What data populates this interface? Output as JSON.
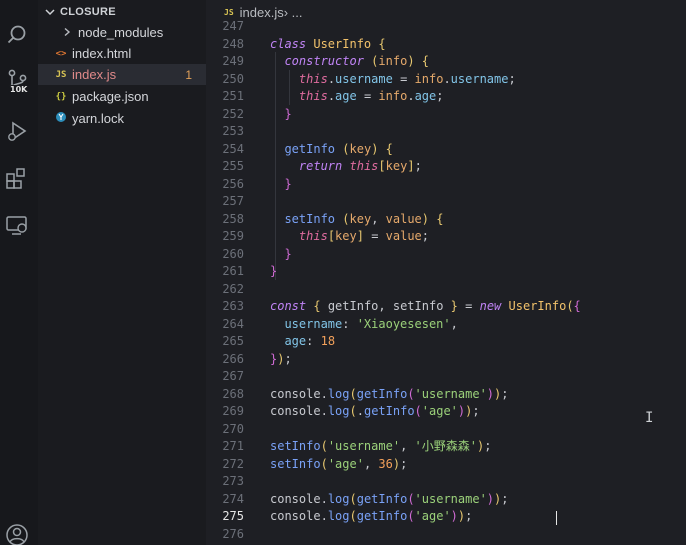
{
  "activity_bar": {
    "icons": [
      "search-icon",
      "source-control-icon",
      "run-debug-icon",
      "extensions-icon",
      "remote-explorer-icon",
      "account-icon"
    ],
    "badge": "10K"
  },
  "explorer": {
    "section_title": "CLOSURE",
    "items": [
      {
        "label": "node_modules",
        "icon": ">",
        "type": "folder"
      },
      {
        "label": "index.html",
        "icon": "<>",
        "type": "html"
      },
      {
        "label": "index.js",
        "icon": "JS",
        "type": "js",
        "count": "1"
      },
      {
        "label": "package.json",
        "icon": "{}",
        "type": "json"
      },
      {
        "label": "yarn.lock",
        "icon": "yarn-icon",
        "type": "yarn"
      }
    ]
  },
  "editor": {
    "breadcrumb_icon": "JS",
    "breadcrumb_file": "index.js",
    "breadcrumb_sep": " › ...",
    "line_numbers": [
      "247",
      "248",
      "249",
      "250",
      "251",
      "252",
      "253",
      "254",
      "255",
      "256",
      "257",
      "258",
      "259",
      "260",
      "261",
      "262",
      "263",
      "264",
      "265",
      "266",
      "267",
      "268",
      "269",
      "270",
      "271",
      "272",
      "273",
      "274",
      "275",
      "276"
    ],
    "current_line": "275",
    "lines": [
      "",
      "class UserInfo {",
      "  constructor (info) {",
      "    this.username = info.username;",
      "    this.age = info.age;",
      "  }",
      "",
      "  getInfo (key) {",
      "    return this[key];",
      "  }",
      "",
      "  setInfo (key, value) {",
      "    this[key] = value;",
      "  }",
      "}",
      "",
      "const { getInfo, setInfo } = new UserInfo({",
      "  username: 'Xiaoyesesen',",
      "  age: 18",
      "});",
      "",
      "console.log(getInfo('username'));",
      "console.log(.getInfo('age'));",
      "",
      "setInfo('username', '小野森森');",
      "setInfo('age', 36);",
      "",
      "console.log(getInfo('username'));",
      "console.log(getInfo('age'));",
      ""
    ]
  },
  "colors": {
    "keyword": "#c084f5",
    "class": "#f2c26b",
    "function": "#7aa2f7",
    "string": "#9bd17a",
    "number": "#f2a05a",
    "this": "#e06c9f",
    "js_badge": "#d8c454"
  }
}
